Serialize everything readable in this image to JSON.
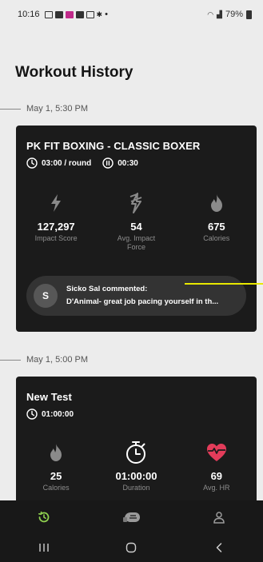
{
  "status_bar": {
    "time": "10:16",
    "battery": "79%",
    "notification_icons": [
      "message-icon",
      "gallery-icon",
      "chat-icon",
      "linkedin-icon",
      "mail-icon",
      "teams-icon"
    ]
  },
  "page": {
    "title": "Workout History"
  },
  "sections": [
    {
      "date": "May 1, 5:30 PM",
      "workout": {
        "title": "PK FIT BOXING - CLASSIC BOXER",
        "round_time": "03:00 / round",
        "rest_time": "00:30",
        "stats": [
          {
            "icon": "lightning-icon",
            "value": "127,297",
            "label": "Impact Score"
          },
          {
            "icon": "impact-icon",
            "value": "54",
            "label": "Avg. Impact Force"
          },
          {
            "icon": "flame-icon",
            "value": "675",
            "label": "Calories"
          }
        ],
        "comment": {
          "avatar_letter": "S",
          "author_line": "Sicko Sal commented:",
          "preview": "D'Animal- great job pacing yourself in th..."
        }
      }
    },
    {
      "date": "May 1, 5:00 PM",
      "workout": {
        "title": "New Test",
        "duration": "01:00:00",
        "stats": [
          {
            "icon": "flame-icon",
            "value": "25",
            "label": "Calories"
          },
          {
            "icon": "stopwatch-icon",
            "value": "01:00:00",
            "label": "Duration"
          },
          {
            "icon": "heart-rate-icon",
            "value": "69",
            "label": "Avg. HR"
          }
        ]
      }
    }
  ],
  "bottom_nav": [
    "history-icon",
    "glove-icon",
    "profile-icon"
  ],
  "colors": {
    "accent_green": "#8fd14f",
    "heart_pink": "#e33c5a",
    "pointer_yellow": "#e8e800",
    "card_bg": "#1b1b1b"
  }
}
